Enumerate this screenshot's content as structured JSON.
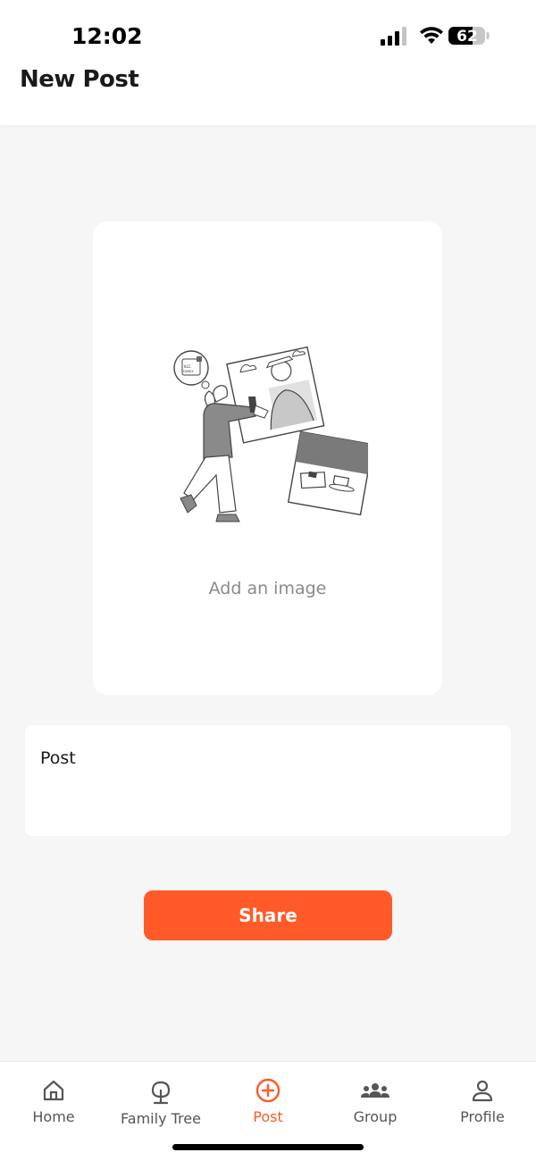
{
  "status_bar": {
    "time": "12:02",
    "battery": "62"
  },
  "header": {
    "title": "New Post"
  },
  "image_picker": {
    "label": "Add an image",
    "badge_line1": "KLC",
    "badge_line2": "FAMILY"
  },
  "post_field": {
    "placeholder": "Post"
  },
  "share_button": {
    "label": "Share"
  },
  "bottom_nav": {
    "items": [
      {
        "label": "Home",
        "icon": "home-icon"
      },
      {
        "label": "Family Tree",
        "icon": "tree-icon"
      },
      {
        "label": "Post",
        "icon": "plus-circle-icon",
        "active": true
      },
      {
        "label": "Group",
        "icon": "group-icon"
      },
      {
        "label": "Profile",
        "icon": "person-icon"
      }
    ]
  },
  "colors": {
    "accent": "#ff5a28",
    "background": "#f6f6f6",
    "card": "#ffffff"
  }
}
